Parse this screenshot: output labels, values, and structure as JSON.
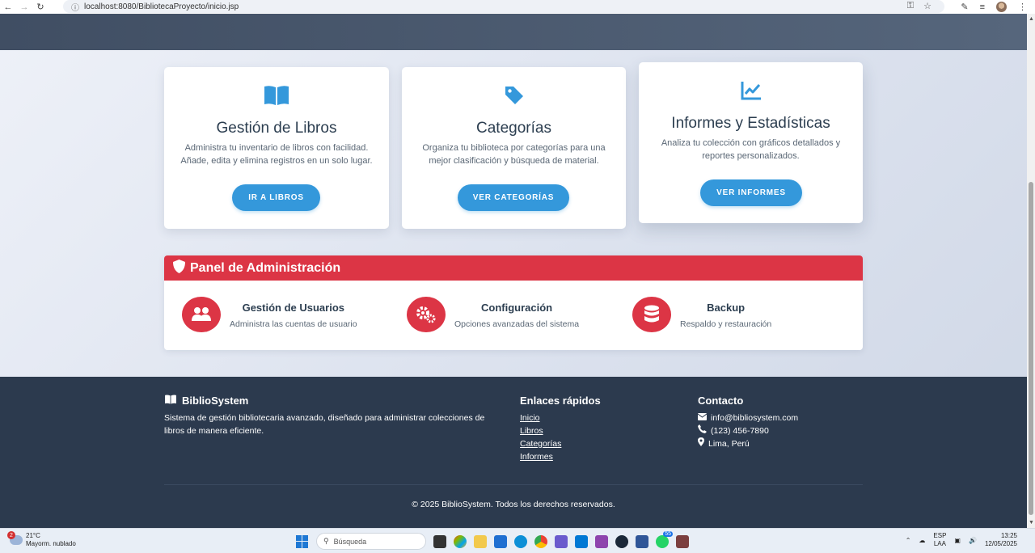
{
  "browser": {
    "url": "localhost:8080/BibliotecaProyecto/inicio.jsp"
  },
  "cards": [
    {
      "title": "Gestión de Libros",
      "description_line1": "Administra tu inventario de libros con facilidad.",
      "description_line2": "Añade, edita y elimina registros en un solo lugar.",
      "button": "IR A LIBROS",
      "icon": "book-open-icon"
    },
    {
      "title": "Categorías",
      "description_line1": "Organiza tu biblioteca por categorías para una",
      "description_line2": "mejor clasificación y búsqueda de material.",
      "button": "VER CATEGORÍAS",
      "icon": "tag-icon"
    },
    {
      "title": "Informes y Estadísticas",
      "description_line1": "Analiza tu colección con gráficos detallados y",
      "description_line2": "reportes personalizados.",
      "button": "VER INFORMES",
      "icon": "chart-line-icon"
    }
  ],
  "admin": {
    "title": "Panel de Administración",
    "items": [
      {
        "title": "Gestión de Usuarios",
        "description": "Administra las cuentas de usuario",
        "icon": "users-icon"
      },
      {
        "title": "Configuración",
        "description": "Opciones avanzadas del sistema",
        "icon": "cogs-icon"
      },
      {
        "title": "Backup",
        "description": "Respaldo y restauración",
        "icon": "database-icon"
      }
    ]
  },
  "footer": {
    "brand": "BiblioSystem",
    "about_line1": "Sistema de gestión bibliotecaria avanzado, diseñado para administrar colecciones de",
    "about_line2": "libros de manera eficiente.",
    "links_title": "Enlaces rápidos",
    "links": [
      "Inicio",
      "Libros",
      "Categorías",
      "Informes"
    ],
    "contact_title": "Contacto",
    "email": "info@bibliosystem.com",
    "phone": "(123) 456-7890",
    "location": "Lima, Perú",
    "copyright": "© 2025 BiblioSystem. Todos los derechos reservados."
  },
  "taskbar": {
    "weather_temp": "21°C",
    "weather_desc": "Mayorm. nublado",
    "weather_badge": "2",
    "search_placeholder": "Búsqueda",
    "whatsapp_badge": "55",
    "lang_top": "ESP",
    "lang_bottom": "LAA",
    "time": "13:25",
    "date": "12/05/2025"
  },
  "colors": {
    "primary": "#3498db",
    "danger": "#dc3545",
    "dark": "#2c3a4e"
  }
}
